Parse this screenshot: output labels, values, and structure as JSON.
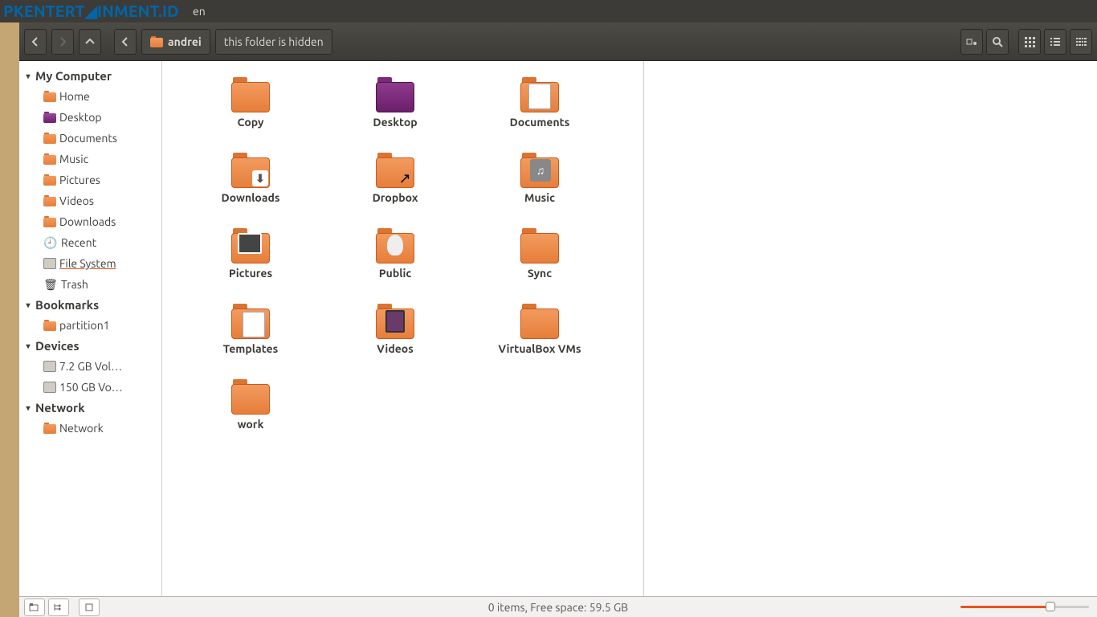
{
  "watermark": "PKENTERT◢INMENT.ID",
  "titlebar_suffix": "en",
  "toolbar": {
    "path_parent": "andrei",
    "path_current": "this folder is hidden"
  },
  "sidebar": {
    "sections": [
      {
        "title": "My Computer",
        "items": [
          {
            "label": "Home",
            "icon": "home"
          },
          {
            "label": "Desktop",
            "icon": "desktop"
          },
          {
            "label": "Documents",
            "icon": "folder"
          },
          {
            "label": "Music",
            "icon": "folder"
          },
          {
            "label": "Pictures",
            "icon": "folder"
          },
          {
            "label": "Videos",
            "icon": "folder"
          },
          {
            "label": "Downloads",
            "icon": "folder"
          },
          {
            "label": "Recent",
            "icon": "recent"
          },
          {
            "label": "File System",
            "icon": "disk",
            "active": true
          },
          {
            "label": "Trash",
            "icon": "trash"
          }
        ]
      },
      {
        "title": "Bookmarks",
        "items": [
          {
            "label": "partition1",
            "icon": "folder"
          }
        ]
      },
      {
        "title": "Devices",
        "items": [
          {
            "label": "7.2 GB Vol…",
            "icon": "disk"
          },
          {
            "label": "150 GB Vo…",
            "icon": "disk"
          }
        ]
      },
      {
        "title": "Network",
        "items": [
          {
            "label": "Network",
            "icon": "folder"
          }
        ]
      }
    ]
  },
  "folders": [
    {
      "label": "Copy",
      "variant": "plain"
    },
    {
      "label": "Desktop",
      "variant": "desktop"
    },
    {
      "label": "Documents",
      "variant": "docpage"
    },
    {
      "label": "Downloads",
      "variant": "download"
    },
    {
      "label": "Dropbox",
      "variant": "dropbox"
    },
    {
      "label": "Music",
      "variant": "music"
    },
    {
      "label": "Pictures",
      "variant": "pictures"
    },
    {
      "label": "Public",
      "variant": "public"
    },
    {
      "label": "Sync",
      "variant": "plain"
    },
    {
      "label": "Templates",
      "variant": "templates"
    },
    {
      "label": "Videos",
      "variant": "videos"
    },
    {
      "label": "VirtualBox VMs",
      "variant": "plain"
    },
    {
      "label": "work",
      "variant": "plain"
    }
  ],
  "status": {
    "text": "0 items, Free space: 59.5 GB"
  }
}
